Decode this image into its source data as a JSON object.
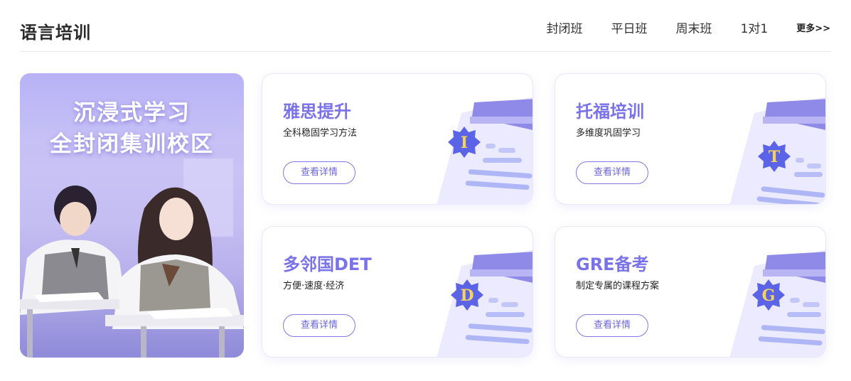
{
  "header": {
    "title": "语言培训",
    "tabs": [
      "封闭班",
      "平日班",
      "周末班",
      "1对1"
    ],
    "more_label": "更多>>"
  },
  "banner": {
    "line1": "沉浸式学习",
    "line2": "全封闭集训校区"
  },
  "cards": [
    {
      "title": "雅思提升",
      "subtitle": "全科稳固学习方法",
      "button": "查看详情",
      "badge_letter": "I"
    },
    {
      "title": "托福培训",
      "subtitle": "多维度巩固学习",
      "button": "查看详情",
      "badge_letter": "T"
    },
    {
      "title": "多邻国DET",
      "subtitle": "方便·速度·经济",
      "button": "查看详情",
      "badge_letter": "D"
    },
    {
      "title": "GRE备考",
      "subtitle": "制定专属的课程方案",
      "button": "查看详情",
      "badge_letter": "G"
    }
  ],
  "colors": {
    "accent": "#7a72e8",
    "badge": "#5b63e6",
    "badge_letter": "#f7d35a"
  }
}
